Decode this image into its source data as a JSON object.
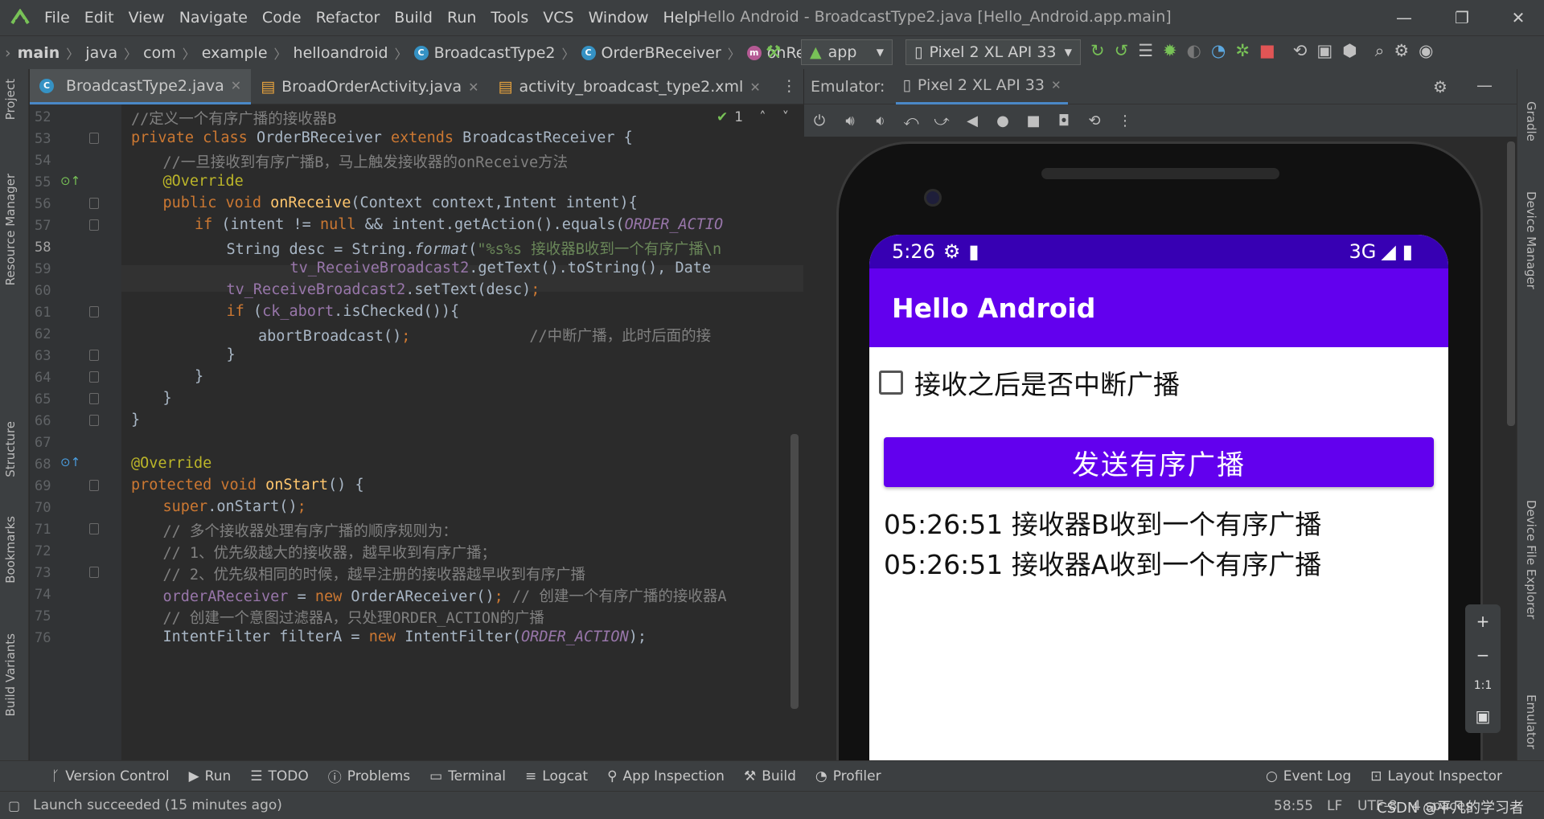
{
  "menu": [
    "File",
    "Edit",
    "View",
    "Navigate",
    "Code",
    "Refactor",
    "Build",
    "Run",
    "Tools",
    "VCS",
    "Window",
    "Help"
  ],
  "window_title": "Hello Android - BroadcastType2.java [Hello_Android.app.main]",
  "breadcrumb": {
    "c0": "main",
    "c1": "java",
    "c2": "com",
    "c3": "example",
    "c4": "helloandroid",
    "c5": "BroadcastType2",
    "c6": "OrderBReceiver",
    "c7": "onReceive"
  },
  "run_config": "app",
  "device": "Pixel 2 XL API 33",
  "editor_tabs": [
    "BroadcastType2.java",
    "BroadOrderActivity.java",
    "activity_broadcast_type2.xml"
  ],
  "inspection_count": "1",
  "left_panels": {
    "project": "Project",
    "resource": "Resource Manager",
    "structure": "Structure",
    "bookmarks": "Bookmarks",
    "variants": "Build Variants"
  },
  "right_panels": {
    "gradle": "Gradle",
    "device_manager": "Device Manager",
    "file_explorer": "Device File Explorer",
    "emulator": "Emulator"
  },
  "line_numbers": [
    "52",
    "53",
    "54",
    "55",
    "56",
    "57",
    "58",
    "59",
    "60",
    "61",
    "62",
    "63",
    "64",
    "65",
    "66",
    "67",
    "68",
    "69",
    "70",
    "71",
    "72",
    "73",
    "74",
    "75",
    "76"
  ],
  "code": {
    "l52": "//定义一个有序广播的接收器B",
    "l53a": "private class ",
    "l53b": "OrderBReceiver ",
    "l53c": "extends ",
    "l53d": "BroadcastReceiver {",
    "l54": "//一旦接收到有序广播B，马上触发接收器的onReceive方法",
    "l55": "@Override",
    "l56a": "public void ",
    "l56b": "onReceive",
    "l56c": "(Context context,Intent intent){",
    "l57a": "if ",
    "l57b": "(intent != ",
    "l57c": "null ",
    "l57d": "&& intent.getAction().equals(",
    "l57e": "ORDER_ACTIO",
    "l58a": "String desc = String.",
    "l58b": "format",
    "l58c": "(",
    "l58d": "\"%s%s 接收器B收到一个有序广播\\n",
    "l59a": "tv_ReceiveBroadcast2",
    "l59b": ".getText().toString(), Date",
    "l60a": "tv_ReceiveBroadcast2",
    "l60b": ".setText(desc)",
    "l60c": ";",
    "l61a": "if ",
    "l61b": "(",
    "l61c": "ck_abort",
    "l61d": ".isChecked()){",
    "l62a": "abortBroadcast()",
    "l62b": ";",
    "l62c": "//中断广播，此时后面的接",
    "l63": "}",
    "l64": "}",
    "l65": "}",
    "l66": "}",
    "l68": "@Override",
    "l69a": "protected void ",
    "l69b": "onStart",
    "l69c": "() {",
    "l70a": "super",
    "l70b": ".onStart()",
    "l70c": ";",
    "l71": "// 多个接收器处理有序广播的顺序规则为：",
    "l72": "// 1、优先级越大的接收器，越早收到有序广播；",
    "l73": "// 2、优先级相同的时候，越早注册的接收器越早收到有序广播",
    "l74a": "orderAReceiver ",
    "l74b": "= ",
    "l74c": "new ",
    "l74d": "OrderAReceiver()",
    "l74e": "; ",
    "l74f": "// 创建一个有序广播的接收器A",
    "l75": "// 创建一个意图过滤器A，只处理ORDER_ACTION的广播",
    "l76a": "IntentFilter filterA = ",
    "l76b": "new ",
    "l76c": "IntentFilter(",
    "l76d": "ORDER_ACTION",
    "l76e": ");"
  },
  "emulator": {
    "label": "Emulator:",
    "tab": "Pixel 2 XL API 33"
  },
  "phone": {
    "time": "5:26",
    "network": "3G",
    "app_title": "Hello Android",
    "checkbox_label": "接收之后是否中断广播",
    "send_button": "发送有序广播",
    "log_lines": [
      "05:26:51 接收器B收到一个有序广播",
      "05:26:51 接收器A收到一个有序广播"
    ]
  },
  "bottom_tools": [
    "Version Control",
    "Run",
    "TODO",
    "Problems",
    "Terminal",
    "Logcat",
    "App Inspection",
    "Build",
    "Profiler"
  ],
  "bottom_right_tools": [
    "Event Log",
    "Layout Inspector"
  ],
  "status": {
    "message": "Launch succeeded (15 minutes ago)",
    "position": "58:55",
    "line_sep": "LF",
    "encoding": "UTF-8",
    "indent": "4 spaces",
    "watermark": "CSDN @平凡的学习者"
  },
  "colors": {
    "accent": "#6200ee",
    "statusbar": "#3700b3",
    "ide_bg": "#2b2b2b",
    "panel": "#3c3f41",
    "keyword": "#cc7832",
    "string": "#6a8759",
    "field": "#9876aa",
    "method": "#ffc66d",
    "annotation": "#bbb529",
    "comment": "#808080"
  }
}
